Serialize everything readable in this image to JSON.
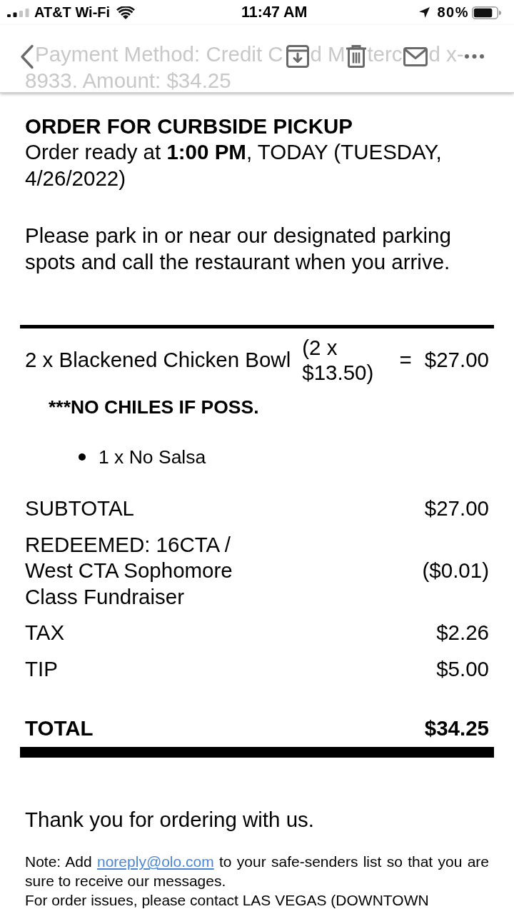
{
  "status_bar": {
    "carrier": "AT&T Wi-Fi",
    "time": "11:47 AM",
    "battery": "80%"
  },
  "nav_bar": {
    "scrolled_text_line_1": [
      "Payment Method: Credit C",
      "d M",
      "terc",
      "d x-"
    ],
    "scrolled_text_line_2": "8933. Amount: $34.25"
  },
  "order": {
    "heading": "ORDER FOR CURBSIDE PICKUP",
    "ready_line": "Order ready at **1:00 PM**, TODAY (TUESDAY, 4/26/2022)",
    "instructions": "Please park in or near our designated parking spots and call the restaurant when you arrive."
  },
  "items": [
    {
      "name": "2 x Blackened Chicken Bowl",
      "unit_price": "(2 x $13.50)",
      "equals": "=",
      "amount": "$27.00",
      "note": "***NO CHILES IF POSS.",
      "modifiers": [
        "1 x No Salsa"
      ]
    }
  ],
  "summary": [
    {
      "label": "SUBTOTAL",
      "amount": "$27.00"
    },
    {
      "label": "REDEEMED: 16CTA / West CTA Sophomore Class Fundraiser",
      "amount": "($0.01)"
    },
    {
      "label": "TAX",
      "amount": "$2.26"
    },
    {
      "label": "TIP",
      "amount": "$5.00"
    }
  ],
  "total": {
    "label": "TOTAL",
    "amount": "$34.25"
  },
  "thank_you": "Thank you for ordering with us.",
  "note": {
    "before": "Note: Add",
    "link": "noreply@olo.com",
    "after": "to your safe-senders list so that you are sure to receive our messages."
  },
  "contact": "For order issues, please contact LAS VEGAS (DOWNTOWN"
}
